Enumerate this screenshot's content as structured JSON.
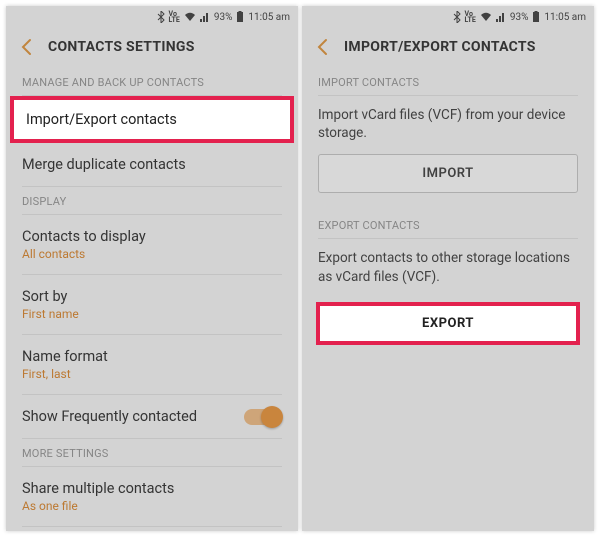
{
  "status": {
    "battery_pct": "93%",
    "time": "11:05 am"
  },
  "left": {
    "title": "CONTACTS SETTINGS",
    "sections": {
      "manage_header": "MANAGE AND BACK UP CONTACTS",
      "import_export": "Import/Export contacts",
      "merge": "Merge duplicate contacts",
      "display_header": "DISPLAY",
      "contacts_to_display": {
        "title": "Contacts to display",
        "sub": "All contacts"
      },
      "sort_by": {
        "title": "Sort by",
        "sub": "First name"
      },
      "name_format": {
        "title": "Name format",
        "sub": "First, last"
      },
      "show_freq": "Show Frequently contacted",
      "more_header": "MORE SETTINGS",
      "share_multiple": {
        "title": "Share multiple contacts",
        "sub": "As one file"
      }
    }
  },
  "right": {
    "title": "IMPORT/EXPORT CONTACTS",
    "import_header": "IMPORT CONTACTS",
    "import_desc": "Import vCard files (VCF) from your device storage.",
    "import_btn": "IMPORT",
    "export_header": "EXPORT CONTACTS",
    "export_desc": "Export contacts to other storage locations as vCard files (VCF).",
    "export_btn": "EXPORT"
  }
}
